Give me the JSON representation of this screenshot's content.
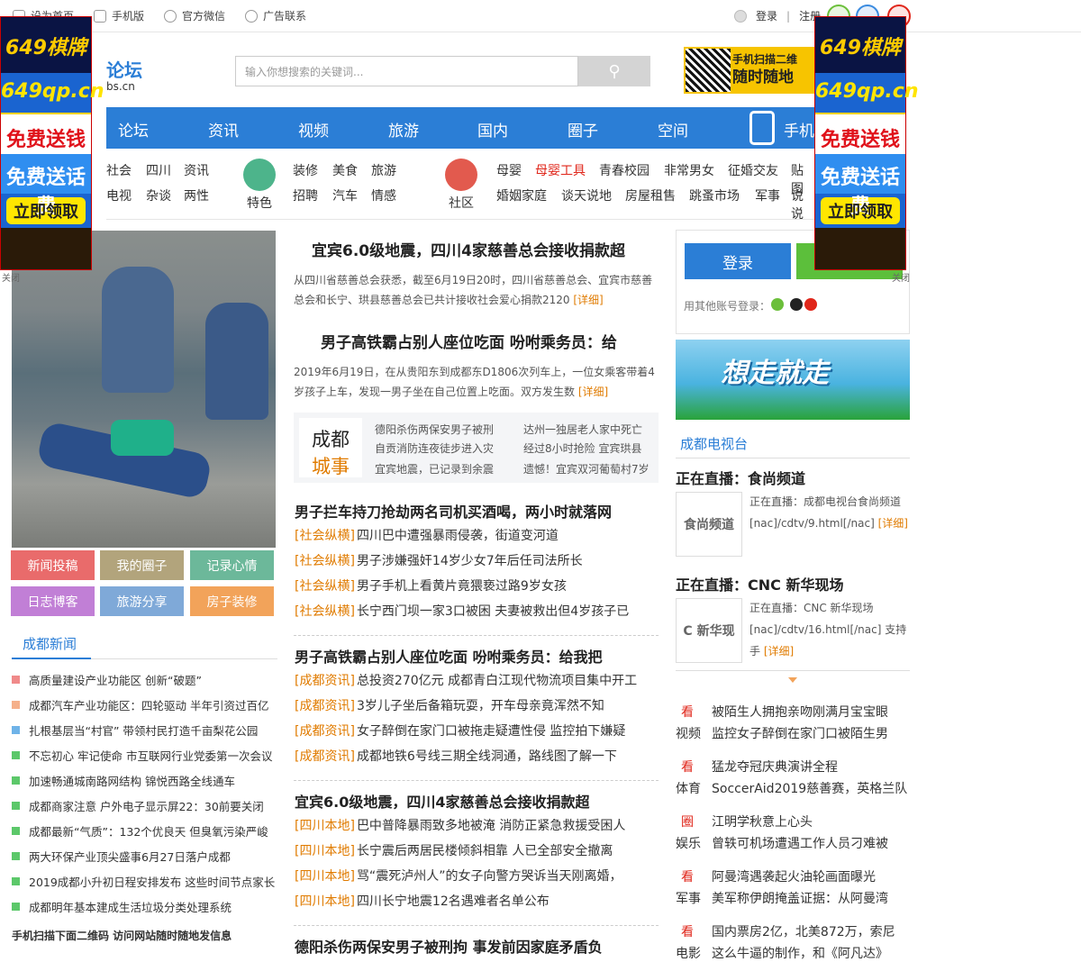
{
  "topbar": {
    "links": [
      "设为首页",
      "手机版",
      "官方微信",
      "广告联系"
    ],
    "login": "登录",
    "register": "注册"
  },
  "header": {
    "logo_text": "论坛",
    "logo_domain": "bs.cn",
    "search_placeholder": "输入你想搜索的关键词...",
    "qr_text_1": "手机扫描二维",
    "qr_text_2": "随时随地"
  },
  "nav": {
    "items": [
      "论坛",
      "资讯",
      "视频",
      "旅游",
      "国内",
      "圈子",
      "空间",
      "手机"
    ]
  },
  "subnav": {
    "group1": [
      "社会",
      "四川",
      "资讯",
      "电视",
      "杂谈",
      "两性"
    ],
    "group2_label": "特色",
    "group2": [
      "装修",
      "美食",
      "旅游",
      "招聘",
      "汽车",
      "情感"
    ],
    "group3_label": "社区",
    "group3": [
      "母婴",
      "母婴工具",
      "青春校园",
      "非常男女",
      "征婚交友",
      "贴图",
      "婚姻家庭",
      "谈天说地",
      "房屋租售",
      "跳蚤市场",
      "军事",
      "说说"
    ]
  },
  "floating_ads": {
    "brand": "649棋牌",
    "domain": "649qp.cn",
    "line1": "免费送钱",
    "line2": "免费送话费",
    "cta": "立即领取",
    "close": "关闭"
  },
  "left": {
    "tiles": [
      {
        "label": "新闻投稿",
        "color": "#e96b6b"
      },
      {
        "label": "我的圈子",
        "color": "#b2a47c"
      },
      {
        "label": "记录心情",
        "color": "#6cb89a"
      },
      {
        "label": "日志博客",
        "color": "#c17fd6"
      },
      {
        "label": "旅游分享",
        "color": "#7fa9d8"
      },
      {
        "label": "房子装修",
        "color": "#f2a35a"
      }
    ],
    "news_title": "成都新闻",
    "news": [
      {
        "text": "高质量建设产业功能区 创新“破题”",
        "color": "#f08a8a"
      },
      {
        "text": "成都汽车产业功能区：四轮驱动 半年引资过百亿",
        "color": "#f5b08a"
      },
      {
        "text": "扎根基层当“村官” 带领村民打造千亩梨花公园",
        "color": "#6fb3e8"
      },
      {
        "text": "不忘初心 牢记使命 市互联网行业党委第一次会议",
        "color": "#5cc86a"
      },
      {
        "text": "加速畅通城南路网结构 锦悦西路全线通车",
        "color": "#5cc86a"
      },
      {
        "text": "成都商家注意 户外电子显示屏22：30前要关闭",
        "color": "#5cc86a"
      },
      {
        "text": "成都最新“气质”：132个优良天 但臭氧污染严峻",
        "color": "#5cc86a"
      },
      {
        "text": "两大环保产业顶尖盛事6月27日落户成都",
        "color": "#5cc86a"
      },
      {
        "text": "2019成都小升初日程安排发布 这些时间节点家长",
        "color": "#5cc86a"
      },
      {
        "text": "成都明年基本建成生活垃圾分类处理系统",
        "color": "#5cc86a"
      }
    ],
    "bottom_text": "手机扫描下面二维码  访问网站随时随地发信息"
  },
  "middle": {
    "articles": [
      {
        "title": "宜宾6.0级地震，四川4家慈善总会接收捐款超",
        "desc": "从四川省慈善总会获悉，截至6月19日20时，四川省慈善总会、宜宾市慈善总会和长宁、珙县慈善总会已共计接收社会爱心捐款2120",
        "more": "[详细]"
      },
      {
        "title": "男子高铁霸占别人座位吃面 吩咐乘务员：给",
        "desc": "2019年6月19日，在从贵阳东到成都东D1806次列车上，一位女乘客带着4岁孩子上车，发现一男子坐在自己位置上吃面。双方发生数",
        "more": "[详细]"
      }
    ],
    "box": {
      "label_1": "成都",
      "label_2": "城事",
      "items": [
        "德阳杀伤两保安男子被刑",
        "达州一独居老人家中死亡",
        "自贡消防连夜徒步进入灾",
        "经过8小时抢险 宜宾珙县",
        "宜宾地震，已记录到余震",
        "遗憾！宜宾双河葡萄村7岁"
      ]
    },
    "sections": [
      {
        "head": "男子拦车持刀抢劫两名司机买酒喝，两小时就落网",
        "tag": "[社会纵横]",
        "items": [
          "四川巴中遭强暴雨侵袭，街道变河道",
          "男子涉嫌强奸14岁少女7年后任司法所长",
          "男子手机上看黄片竟猥亵过路9岁女孩",
          "长宁西门坝一家3口被困 夫妻被救出但4岁孩子已"
        ]
      },
      {
        "head": "男子高铁霸占别人座位吃面 吩咐乘务员：给我把",
        "tag": "[成都资讯]",
        "items": [
          "总投资270亿元 成都青白江现代物流项目集中开工",
          "3岁儿子坐后备箱玩耍，开车母亲竟浑然不知",
          "女子醉倒在家门口被拖走疑遭性侵 监控拍下嫌疑",
          "成都地铁6号线三期全线洞通，路线图了解一下"
        ]
      },
      {
        "head": "宜宾6.0级地震，四川4家慈善总会接收捐款超",
        "tag": "[四川本地]",
        "items": [
          "巴中普降暴雨致多地被淹 消防正紧急救援受困人",
          "长宁震后两居民楼倾斜相靠 人已全部安全撤离",
          "骂“震死泸州人”的女子向警方哭诉当天刚离婚，",
          "四川长宁地震12名遇难者名单公布"
        ]
      },
      {
        "head": "德阳杀伤两保安男子被刑拘 事发前因家庭矛盾负",
        "tag": "",
        "items": []
      }
    ]
  },
  "right": {
    "login_btn": "登录",
    "other_login": "用其他账号登录：",
    "banner_text": "想走就走",
    "tv_title": "成都电视台",
    "live": [
      {
        "title": "正在直播：食尚频道",
        "thumb": "食尚频道",
        "desc": "正在直播：成都电视台食尚频道 [nac]/cdtv/9.html[/nac]",
        "more": "[详细]"
      },
      {
        "title": "正在直播：CNC 新华现场",
        "thumb": "C 新华现",
        "desc": "正在直播：CNC 新华现场 [nac]/cdtv/16.html[/nac] 支持手",
        "more": "[详细]"
      }
    ],
    "videos": [
      {
        "tag_top": "看",
        "tag_bot": "视频",
        "l1": "被陌生人拥抱亲吻刚满月宝宝眼",
        "l2": "监控女子醉倒在家门口被陌生男"
      },
      {
        "tag_top": "看",
        "tag_bot": "体育",
        "l1": "猛龙夺冠庆典演讲全程",
        "l2": "SoccerAid2019慈善赛，英格兰队"
      },
      {
        "tag_top": "圈",
        "tag_bot": "娱乐",
        "l1": "江明学秋意上心头",
        "l2": "曾轶可机场遭遇工作人员刁难被"
      },
      {
        "tag_top": "看",
        "tag_bot": "军事",
        "l1": "阿曼湾遇袭起火油轮画面曝光",
        "l2": "美军称伊朗掩盖证据：从阿曼湾"
      },
      {
        "tag_top": "看",
        "tag_bot": "电影",
        "l1": "国内票房2亿，北美872万，索尼",
        "l2": "这么牛逼的制作，和《阿凡达》"
      }
    ]
  }
}
